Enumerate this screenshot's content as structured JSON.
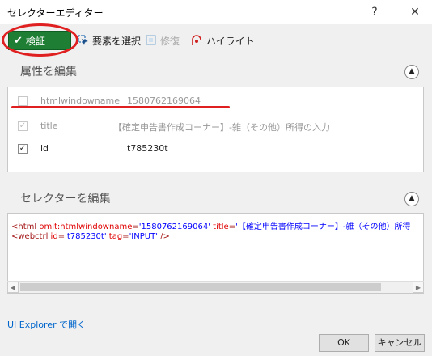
{
  "window": {
    "title": "セレクターエディター",
    "help_label": "?",
    "close_label": "✕"
  },
  "toolbar": {
    "validate_label": "検証",
    "select_element_label": "要素を選択",
    "repair_label": "修復",
    "highlight_label": "ハイライト"
  },
  "attributes_section": {
    "title": "属性を編集",
    "rows": [
      {
        "name": "htmlwindowname",
        "value": "1580762169064",
        "checked": false,
        "disabled": true
      },
      {
        "name": "title",
        "value": "【確定申告書作成コーナー】-雑（その他）所得の入力",
        "checked": true,
        "disabled": true
      },
      {
        "name": "id",
        "value": "t785230t",
        "checked": true,
        "disabled": false
      }
    ]
  },
  "selector_section": {
    "title": "セレクターを編集",
    "line1": {
      "open": "<html ",
      "a1": "omit:htmlwindowname",
      "eq1": "=",
      "v1": "'1580762169064'",
      "a2": " title",
      "eq2": "=",
      "v2": "'【確定申告書作成コーナー】-雑（その他）所得",
      "close": ""
    },
    "line2": {
      "open": "<webctrl ",
      "a1": "id",
      "eq1": "=",
      "v1": "'t785230t'",
      "a2": " tag",
      "eq2": "=",
      "v2": "'INPUT'",
      "close": " />"
    }
  },
  "footer": {
    "explorer_link": "UI Explorer で開く",
    "ok_label": "OK",
    "cancel_label": "キャンセル"
  },
  "colors": {
    "validate_green": "#1e7e34",
    "annotation_red": "#e02020",
    "link_blue": "#0066cc"
  }
}
